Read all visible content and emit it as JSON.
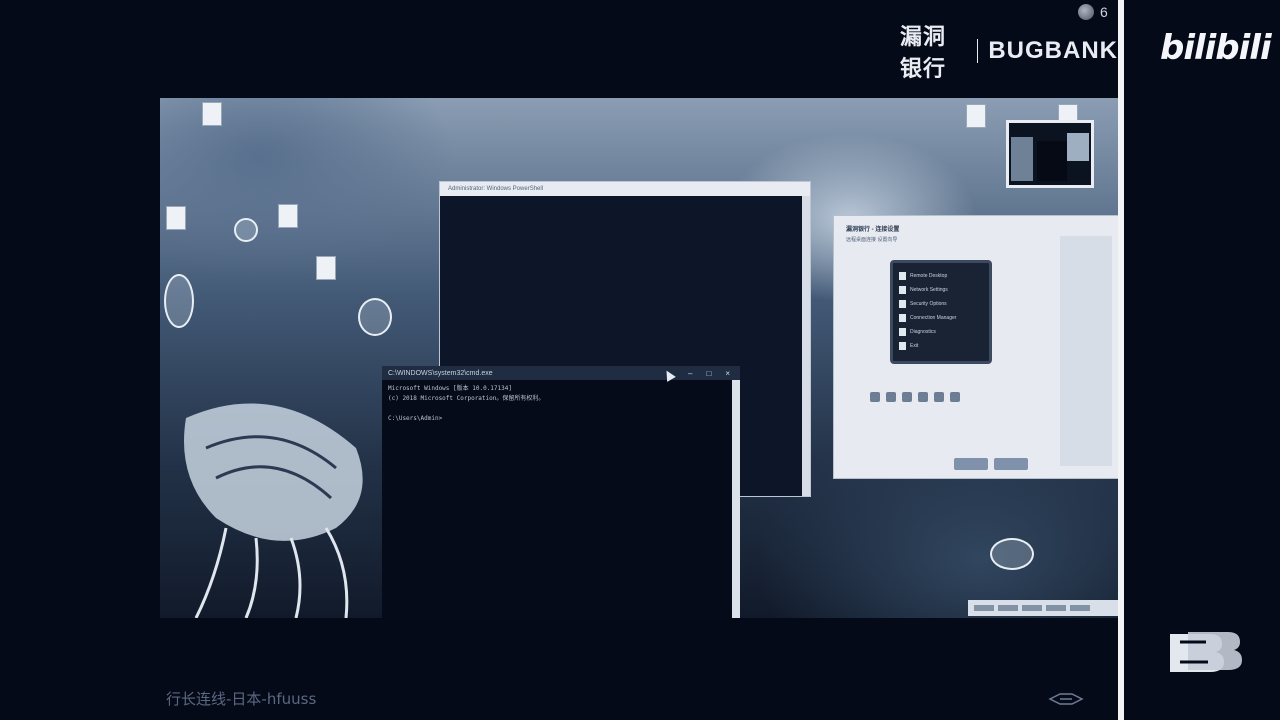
{
  "branding": {
    "title_cn": "漏洞银行",
    "title_en": "BUGBANK",
    "platform": "bilibili",
    "viewer_count": "6"
  },
  "caption": {
    "text": "行长连线-日本-hfuuss"
  },
  "colors": {
    "background": "#050a19",
    "divider": "#f3f4f6",
    "text_light": "#e9ecf2",
    "caption": "#5a6880"
  },
  "desktop": {
    "front_window": {
      "title": "C:\\WINDOWS\\system32\\cmd.exe",
      "controls": [
        "–",
        "□",
        "×"
      ],
      "console_lines": [
        "Microsoft Windows [版本 10.0.17134]",
        "(c) 2018 Microsoft Corporation。保留所有权利。",
        "",
        "C:\\Users\\Admin>"
      ]
    },
    "back_window": {
      "title": "Administrator: Windows PowerShell"
    },
    "app_window": {
      "title": "漏洞银行 - 连接设置",
      "subtitle": "远程桌面连接 设置向导",
      "panel_items": [
        "Remote Desktop",
        "Network Settings",
        "Security Options",
        "Connection Manager",
        "Diagnostics",
        "Exit"
      ]
    }
  }
}
